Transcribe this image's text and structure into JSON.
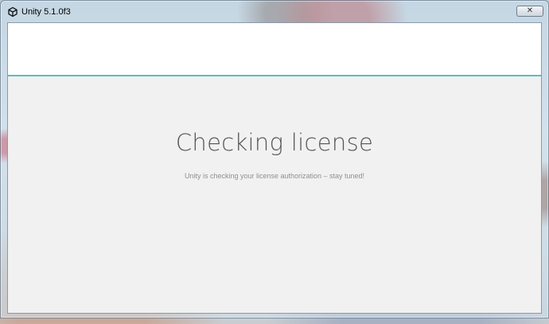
{
  "window": {
    "title": "Unity 5.1.0f3",
    "app_icon": "unity-logo-icon",
    "close_icon": "close-icon",
    "close_glyph": "✕"
  },
  "content": {
    "heading": "Checking license",
    "message": "Unity is checking your license authorization – stay tuned!"
  },
  "colors": {
    "accent_line": "#5dbcc4",
    "content_bg": "#f1f1f1",
    "header_bg": "#ffffff"
  }
}
